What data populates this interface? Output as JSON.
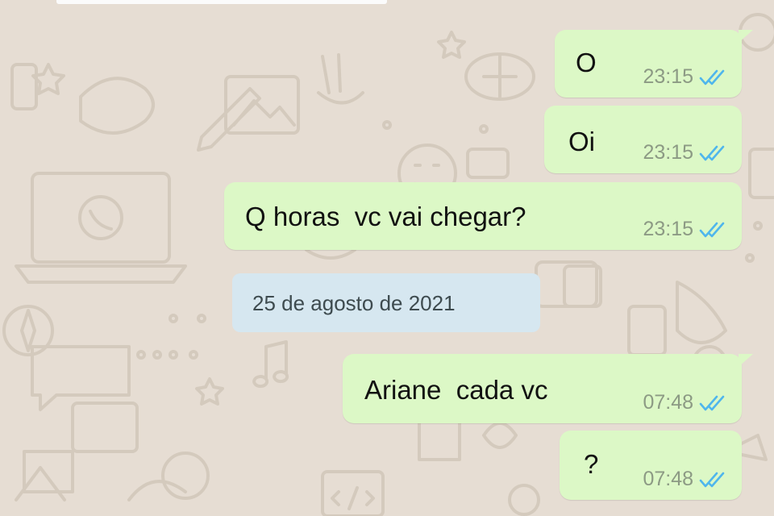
{
  "conversation": {
    "messages": [
      {
        "text": "O",
        "time": "23:15",
        "status": "read"
      },
      {
        "text": "Oi",
        "time": "23:15",
        "status": "read"
      },
      {
        "text": "Q horas  vc vai chegar?",
        "time": "23:15",
        "status": "read"
      },
      {
        "text": "Ariane  cada vc",
        "time": "07:48",
        "status": "read"
      },
      {
        "text": "?",
        "time": "07:48",
        "status": "read"
      }
    ],
    "date_separator": "25 de agosto de 2021"
  },
  "colors": {
    "wallpaper": "#e6ddd3",
    "outgoing_bubble": "#dcf8c6",
    "date_chip": "#d6e7f0",
    "read_ticks": "#4fb6ec",
    "time_text": "#8c9a84"
  },
  "icons": {
    "read_status": "double-check-icon"
  }
}
